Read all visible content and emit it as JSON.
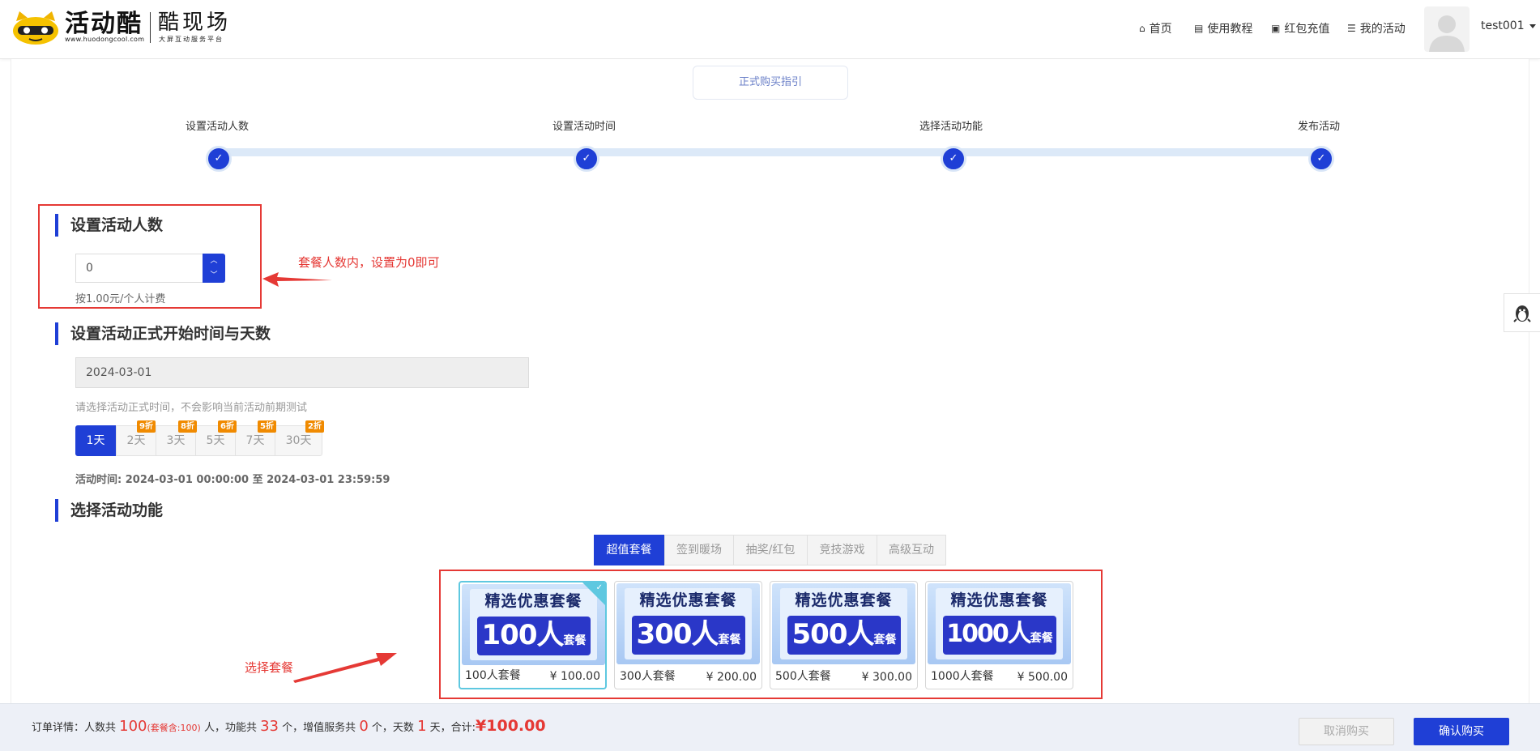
{
  "header": {
    "logo_text": "活动酷",
    "logo_url": "www.huodongcool.com",
    "brand": "酷现场",
    "slogan": "大屏互动服务平台",
    "nav": [
      {
        "label": "首页",
        "icon": "home-icon"
      },
      {
        "label": "使用教程",
        "icon": "document-icon"
      },
      {
        "label": "红包充值",
        "icon": "wallet-icon"
      },
      {
        "label": "我的活动",
        "icon": "list-icon"
      }
    ],
    "username": "test001"
  },
  "guide_button": "正式购买指引",
  "steps": [
    "设置活动人数",
    "设置活动时间",
    "选择活动功能",
    "发布活动"
  ],
  "people": {
    "title": "设置活动人数",
    "value": "0",
    "rate_hint": "按1.00元/个人计费",
    "annotation": "套餐人数内，设置为0即可"
  },
  "time": {
    "title": "设置活动正式开始时间与天数",
    "date": "2024-03-01",
    "hint": "请选择活动正式时间，不会影响当前活动前期测试",
    "days": [
      {
        "label": "1天",
        "discount": "",
        "active": true
      },
      {
        "label": "2天",
        "discount": "9折",
        "active": false
      },
      {
        "label": "3天",
        "discount": "8折",
        "active": false
      },
      {
        "label": "5天",
        "discount": "6折",
        "active": false
      },
      {
        "label": "7天",
        "discount": "5折",
        "active": false
      },
      {
        "label": "30天",
        "discount": "2折",
        "active": false
      }
    ],
    "range_text": "活动时间: 2024-03-01 00:00:00 至 2024-03-01 23:59:59"
  },
  "functions": {
    "title": "选择活动功能",
    "tabs": [
      "超值套餐",
      "签到暖场",
      "抽奖/红包",
      "竞技游戏",
      "高级互动"
    ],
    "active_tab": "超值套餐",
    "annotation": "选择套餐",
    "packages": [
      {
        "banner_title": "精选优惠套餐",
        "banner_big": "100人",
        "banner_small": "套餐",
        "name": "100人套餐",
        "price": "¥ 100.00",
        "selected": true
      },
      {
        "banner_title": "精选优惠套餐",
        "banner_big": "300人",
        "banner_small": "套餐",
        "name": "300人套餐",
        "price": "¥ 200.00",
        "selected": false
      },
      {
        "banner_title": "精选优惠套餐",
        "banner_big": "500人",
        "banner_small": "套餐",
        "name": "500人套餐",
        "price": "¥ 300.00",
        "selected": false
      },
      {
        "banner_title": "精选优惠套餐",
        "banner_big": "1000人",
        "banner_small": "套餐",
        "name": "1000人套餐",
        "price": "¥ 500.00",
        "selected": false
      }
    ]
  },
  "footer": {
    "label": "订单详情：人数共",
    "people_count": "100",
    "people_note": "(套餐含:100)",
    "people_unit": "人，功能共",
    "function_count": "33",
    "function_unit": "个，增值服务共",
    "service_count": "0",
    "service_unit": "个，天数",
    "days_count": "1",
    "days_unit": "天，合计:",
    "total": "¥100.00",
    "cancel_label": "取消购买",
    "confirm_label": "确认购买"
  },
  "colors": {
    "accent": "#1f3fd6",
    "annotation_red": "#e53935",
    "discount_orange": "#f08a00",
    "selected_cyan": "#5ec8e0"
  }
}
